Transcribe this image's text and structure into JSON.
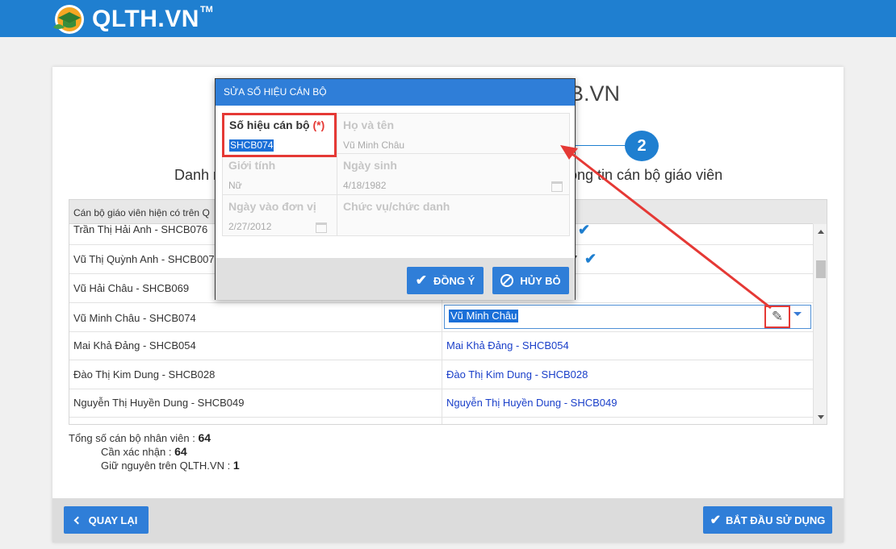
{
  "header": {
    "brand": "QLTH.VN",
    "tm": "TM"
  },
  "panel": {
    "title": "B.VN",
    "step_number": "2",
    "step_left": "Danh m",
    "step_right": "ông tin cán bộ giáo viên"
  },
  "grid": {
    "header_left": "Cán bộ giáo viên hiện có trên Q",
    "rows": [
      {
        "left": "Trần Thị Hải Anh - SHCB076",
        "right": "",
        "check": true
      },
      {
        "left": "Vũ Thị Quỳnh Anh - SHCB007",
        "right": "7",
        "check": true
      },
      {
        "left": "Vũ Hải Châu - SHCB069",
        "right": "",
        "check": false
      },
      {
        "left": "Vũ Minh Châu - SHCB074",
        "right": "Vũ Minh Châu",
        "check": false
      },
      {
        "left": "Mai Khả Đảng - SHCB054",
        "right": "Mai Khả Đảng - SHCB054",
        "check": false
      },
      {
        "left": "Đào Thị Kim Dung - SHCB028",
        "right": "Đào Thị Kim Dung - SHCB028",
        "check": false
      },
      {
        "left": "Nguyễn Thị Huyền Dung - SHCB049",
        "right": "Nguyễn Thị Huyền Dung - SHCB049",
        "check": false
      }
    ],
    "edit_icon": "pencil-icon"
  },
  "summary": {
    "total_label": "Tổng số cán bộ nhân viên : ",
    "total_value": "64",
    "confirm_label": "Cần xác nhận : ",
    "confirm_value": "64",
    "keep_label": "Giữ nguyên trên QLTH.VN : ",
    "keep_value": "1"
  },
  "footer": {
    "back_label": "QUAY LẠI",
    "start_label": "BẮT ĐẦU SỬ DỤNG"
  },
  "dialog": {
    "title": "SỬA SỐ HIỆU CÁN BỘ",
    "fields": {
      "code_label": "Số hiệu cán bộ",
      "code_required": "(*)",
      "code_value": "SHCB074",
      "name_label": "Họ và tên",
      "name_value": "Vũ Minh Châu",
      "gender_label": "Giới tính",
      "gender_value": "Nữ",
      "dob_label": "Ngày sinh",
      "dob_value": "4/18/1982",
      "join_label": "Ngày vào đơn vị",
      "join_value": "2/27/2012",
      "position_label": "Chức vụ/chức danh",
      "position_value": ""
    },
    "ok_label": "ĐỒNG Ý",
    "cancel_label": "HỦY BỎ"
  },
  "colors": {
    "primary": "#2f7ed8",
    "header": "#1f7fd0",
    "highlight": "#e53935",
    "link": "#1a3fc9"
  }
}
